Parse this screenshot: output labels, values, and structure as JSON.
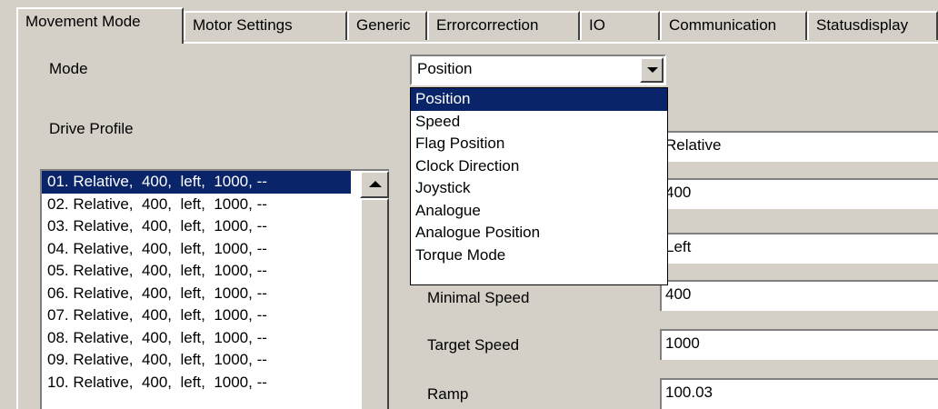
{
  "tabs": [
    {
      "label": "Movement Mode",
      "active": true
    },
    {
      "label": "Motor Settings",
      "active": false
    },
    {
      "label": "Generic",
      "active": false
    },
    {
      "label": "Errorcorrection",
      "active": false
    },
    {
      "label": "IO",
      "active": false
    },
    {
      "label": "Communication",
      "active": false
    },
    {
      "label": "Statusdisplay",
      "active": false
    }
  ],
  "mode": {
    "label": "Mode",
    "selected": "Position",
    "options": [
      "Position",
      "Speed",
      "Flag Position",
      "Clock Direction",
      "Joystick",
      "Analogue",
      "Analogue Position",
      "Torque Mode"
    ]
  },
  "drive_profile": {
    "label": "Drive Profile",
    "items": [
      "01. Relative,  400,  left,  1000, --",
      "02. Relative,  400,  left,  1000, --",
      "03. Relative,  400,  left,  1000, --",
      "04. Relative,  400,  left,  1000, --",
      "05. Relative,  400,  left,  1000, --",
      "06. Relative,  400,  left,  1000, --",
      "07. Relative,  400,  left,  1000, --",
      "08. Relative,  400,  left,  1000, --",
      "09. Relative,  400,  left,  1000, --",
      "10. Relative,  400,  left,  1000, --"
    ],
    "selected_index": 0
  },
  "fields": {
    "position_mode": {
      "value": "Relative"
    },
    "travel_distance": {
      "value": "400"
    },
    "direction": {
      "value": "Left"
    },
    "minimal_speed": {
      "label": "Minimal Speed",
      "value": "400"
    },
    "target_speed": {
      "label": "Target Speed",
      "value": "1000"
    },
    "ramp": {
      "label": "Ramp",
      "value": "100.03"
    }
  },
  "colors": {
    "face": "#d4d0c8",
    "selection": "#0a246a",
    "window": "#ffffff"
  }
}
